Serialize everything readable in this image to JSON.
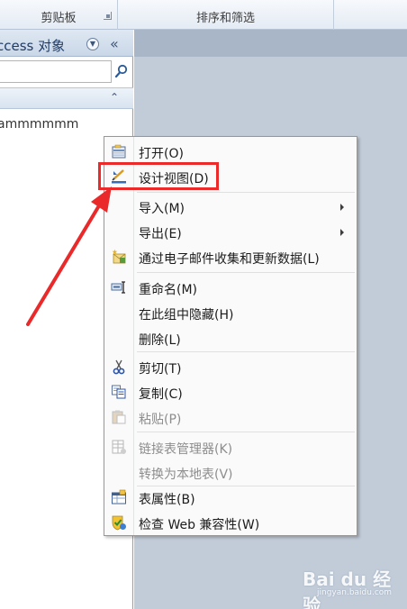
{
  "ribbon": {
    "groups": [
      {
        "label": "剪贴板"
      },
      {
        "label": "排序和筛选"
      }
    ]
  },
  "nav_pane": {
    "title": "ccess 对象",
    "search_placeholder": "",
    "item": "ammmmmm"
  },
  "context_menu": {
    "items": [
      {
        "label": "打开(O)",
        "icon": "open-icon",
        "disabled": false
      },
      {
        "label": "设计视图(D)",
        "icon": "design-view-icon",
        "disabled": false
      },
      {
        "label": "导入(M)",
        "icon": "",
        "disabled": false,
        "submenu": true
      },
      {
        "label": "导出(E)",
        "icon": "",
        "disabled": false,
        "submenu": true
      },
      {
        "label": "通过电子邮件收集和更新数据(L)",
        "icon": "email-collect-icon",
        "disabled": false
      },
      {
        "label": "重命名(M)",
        "icon": "rename-icon",
        "disabled": false
      },
      {
        "label": "在此组中隐藏(H)",
        "icon": "",
        "disabled": false
      },
      {
        "label": "删除(L)",
        "icon": "",
        "disabled": false
      },
      {
        "label": "剪切(T)",
        "icon": "cut-icon",
        "disabled": false
      },
      {
        "label": "复制(C)",
        "icon": "copy-icon",
        "disabled": false
      },
      {
        "label": "粘贴(P)",
        "icon": "paste-icon",
        "disabled": true
      },
      {
        "label": "链接表管理器(K)",
        "icon": "linked-table-manager-icon",
        "disabled": true
      },
      {
        "label": "转换为本地表(V)",
        "icon": "",
        "disabled": true
      },
      {
        "label": "表属性(B)",
        "icon": "table-properties-icon",
        "disabled": false
      },
      {
        "label": "检查 Web 兼容性(W)",
        "icon": "web-compatibility-icon",
        "disabled": false
      }
    ]
  },
  "watermark": {
    "text": "Bai du 经验",
    "sub": "jingyan.baidu.com"
  },
  "colors": {
    "highlight": "#ec2a2a",
    "menu_bg": "#fafafa"
  }
}
